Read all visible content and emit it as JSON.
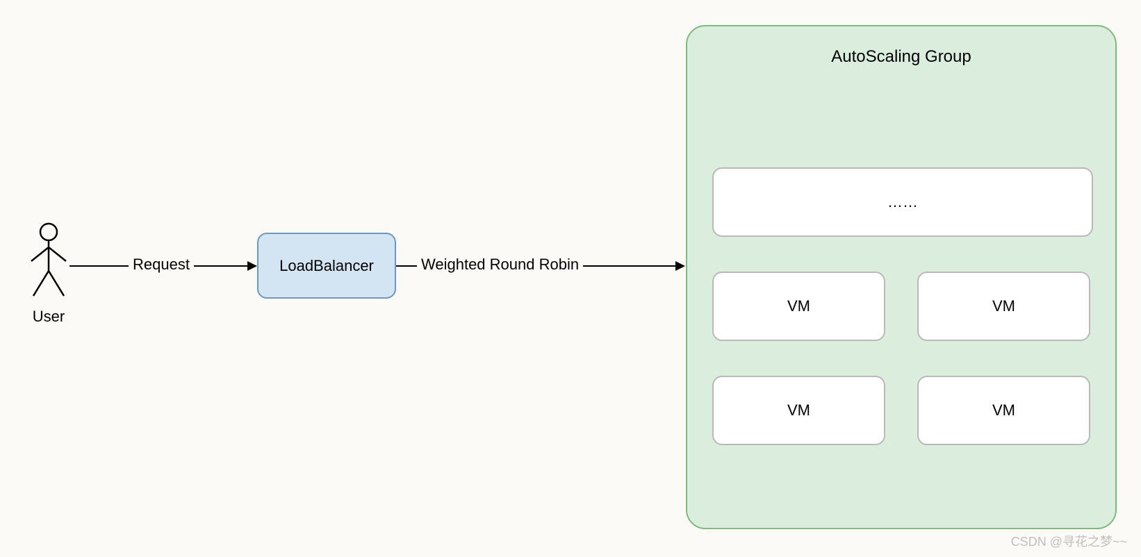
{
  "actors": {
    "user": {
      "label": "User"
    }
  },
  "nodes": {
    "loadbalancer": {
      "label": "LoadBalancer"
    },
    "autoscaling_group": {
      "title": "AutoScaling Group",
      "placeholder": "……",
      "vms": [
        "VM",
        "VM",
        "VM",
        "VM"
      ]
    }
  },
  "arrows": {
    "request": {
      "label": "Request"
    },
    "wrr": {
      "label": "Weighted Round Robin"
    }
  },
  "watermark": "CSDN @寻花之梦~~"
}
